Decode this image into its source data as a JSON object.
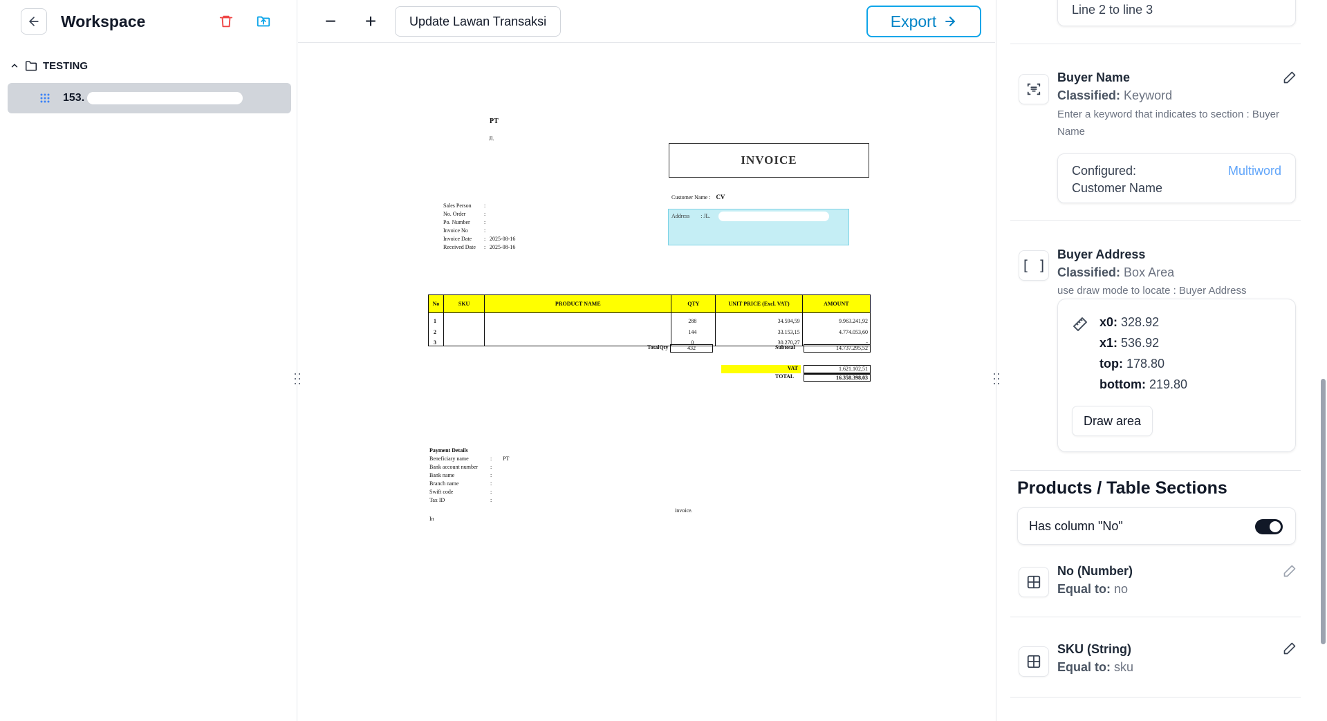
{
  "sidebar": {
    "title": "Workspace",
    "folder": "TESTING",
    "file_prefix": "153."
  },
  "toolbar": {
    "zoom_out": "−",
    "zoom_in": "+",
    "update_label": "Update Lawan Transaksi",
    "export_label": "Export"
  },
  "document": {
    "company": "PT",
    "address_prefix": "Jl.",
    "heading": "INVOICE",
    "meta": [
      {
        "label": "Sales Person",
        "value": ""
      },
      {
        "label": "No. Order",
        "value": ""
      },
      {
        "label": "Po. Number",
        "value": ""
      },
      {
        "label": "Invoice No",
        "value": ""
      },
      {
        "label": "Invoice Date",
        "value": "2025-08-16"
      },
      {
        "label": "Received Date",
        "value": "2025-08-16"
      }
    ],
    "customer_label": "Customer Name :",
    "customer_value": "CV",
    "address_label": "Address",
    "address_value": ": JL.",
    "table_headers": [
      "No",
      "SKU",
      "PRODUCT NAME",
      "QTY",
      "UNIT PRICE (Excl. VAT)",
      "AMOUNT"
    ],
    "rows": [
      {
        "no": "1",
        "qty": "288",
        "price": "34.594,59",
        "amount": "9.963.241,92"
      },
      {
        "no": "2",
        "qty": "144",
        "price": "33.153,15",
        "amount": "4.774.053,60"
      },
      {
        "no": "3",
        "qty": "0",
        "price": "30.270,27",
        "amount": "-"
      }
    ],
    "totalqty_label": "TotalQty",
    "totalqty_value": "432",
    "subtotal_label": "Subtotal",
    "subtotal_value": "14.737.295,52",
    "vat_label": "VAT",
    "vat_value": "1.621.102,51",
    "total_label": "TOTAL",
    "total_value": "16.358.398,03",
    "payment_heading": "Payment Details",
    "payment": [
      {
        "label": "Beneficiary name",
        "value": "PT"
      },
      {
        "label": "Bank account number",
        "value": ""
      },
      {
        "label": "Bank name",
        "value": ""
      },
      {
        "label": "Branch name",
        "value": ""
      },
      {
        "label": "Swift code",
        "value": ""
      },
      {
        "label": "Tax ID",
        "value": ""
      }
    ],
    "note_right": "invoice.",
    "note_line2": "In"
  },
  "panel": {
    "top_card_text": "Line 2 to line 3",
    "buyer_name": {
      "title": "Buyer Name",
      "classified_label": "Classified:",
      "classified_value": "Keyword",
      "desc": "Enter a keyword that indicates to section : Buyer Name",
      "configured_label": "Configured:",
      "configured_value": "Customer Name",
      "tag": "Multiword"
    },
    "buyer_address": {
      "title": "Buyer Address",
      "classified_label": "Classified:",
      "classified_value": "Box Area",
      "desc": "use draw mode to locate : Buyer Address",
      "x0_label": "x0:",
      "x0": "328.92",
      "x1_label": "x1:",
      "x1": "536.92",
      "top_label": "top:",
      "top": "178.80",
      "bottom_label": "bottom:",
      "bottom": "219.80",
      "draw_label": "Draw area"
    },
    "products_title": "Products / Table Sections",
    "has_column_label": "Has column \"No\"",
    "has_column_on": true,
    "col_no": {
      "title": "No (Number)",
      "equal_label": "Equal to:",
      "equal_value": "no"
    },
    "col_sku": {
      "title": "SKU (String)",
      "equal_label": "Equal to:",
      "equal_value": "sku"
    }
  },
  "colors": {
    "accent": "#0ea5e9",
    "danger": "#ef4444",
    "highlight_yellow": "#ffff00",
    "address_highlight": "#c5eef5",
    "tag_blue": "#60a5fa"
  }
}
